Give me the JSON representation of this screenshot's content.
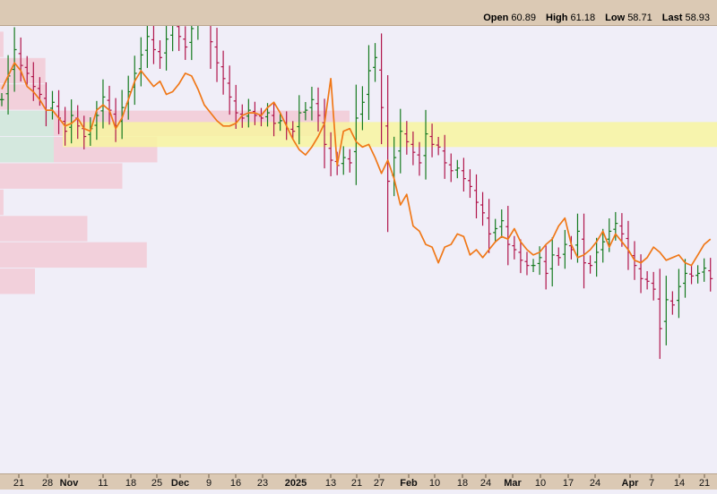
{
  "header": {
    "open_label": "Open",
    "open_value": "60.89",
    "high_label": "High",
    "high_value": "61.18",
    "low_label": "Low",
    "low_value": "58.71",
    "last_label": "Last",
    "last_value": "58.93"
  },
  "chart_data": {
    "type": "ohlc",
    "ylim": [
      51,
      68
    ],
    "grid": false,
    "legend": "none",
    "colors": {
      "up": "#157a1f",
      "down": "#b0154b",
      "sma": "#f07818",
      "highlight_band": "#f8f4a0",
      "profile": "#f2d0db",
      "profile_value_area": "#d4e8de",
      "frame": "#dbc9b4"
    },
    "date_ticks": [
      {
        "label": "21",
        "bold": false
      },
      {
        "label": "28",
        "bold": false
      },
      {
        "label": "Nov",
        "bold": true
      },
      {
        "label": "11",
        "bold": false
      },
      {
        "label": "18",
        "bold": false
      },
      {
        "label": "25",
        "bold": false
      },
      {
        "label": "Dec",
        "bold": true
      },
      {
        "label": "9",
        "bold": false
      },
      {
        "label": "16",
        "bold": false
      },
      {
        "label": "23",
        "bold": false
      },
      {
        "label": "2025",
        "bold": true
      },
      {
        "label": "13",
        "bold": false
      },
      {
        "label": "21",
        "bold": false
      },
      {
        "label": "27",
        "bold": false
      },
      {
        "label": "Feb",
        "bold": true
      },
      {
        "label": "10",
        "bold": false
      },
      {
        "label": "18",
        "bold": false
      },
      {
        "label": "24",
        "bold": false
      },
      {
        "label": "Mar",
        "bold": true
      },
      {
        "label": "10",
        "bold": false
      },
      {
        "label": "17",
        "bold": false
      },
      {
        "label": "24",
        "bold": false
      },
      {
        "label": "Apr",
        "bold": true
      },
      {
        "label": "7",
        "bold": false
      },
      {
        "label": "14",
        "bold": false
      },
      {
        "label": "21",
        "bold": false
      }
    ],
    "highlight_band_range": [
      63.4,
      64.35
    ],
    "volume_profile": [
      {
        "low": 66.8,
        "high": 67.8,
        "volume": 1
      },
      {
        "low": 65.8,
        "high": 66.8,
        "volume": 13
      },
      {
        "low": 64.8,
        "high": 65.8,
        "volume": 13
      },
      {
        "low": 63.8,
        "high": 64.8,
        "volume": 100,
        "value_area": true
      },
      {
        "low": 62.8,
        "high": 63.8,
        "volume": 45,
        "value_area": true
      },
      {
        "low": 61.8,
        "high": 62.8,
        "volume": 35
      },
      {
        "low": 60.8,
        "high": 61.8,
        "volume": 1
      },
      {
        "low": 59.8,
        "high": 60.8,
        "volume": 25
      },
      {
        "low": 58.8,
        "high": 59.8,
        "volume": 42
      },
      {
        "low": 57.8,
        "high": 58.8,
        "volume": 10
      }
    ],
    "close_prices": [
      65.2,
      66.1,
      67.1,
      66.5,
      66.2,
      65.7,
      65.4,
      64.8,
      65.1,
      64.5,
      64.0,
      64.6,
      64.2,
      63.8,
      64.1,
      64.6,
      65.3,
      64.8,
      64.2,
      64.9,
      65.5,
      66.2,
      66.9,
      67.6,
      67.1,
      66.8,
      67.5,
      68.1,
      67.6,
      67.2,
      67.9,
      68.4,
      68.7,
      67.4,
      66.6,
      66.0,
      65.3,
      64.7,
      64.5,
      64.8,
      64.6,
      64.5,
      64.7,
      64.3,
      64.4,
      64.1,
      64.0,
      64.7,
      64.8,
      65.2,
      64.6,
      63.5,
      62.9,
      62.7,
      63.0,
      62.8,
      64.5,
      65.1,
      66.3,
      66.8,
      64.9,
      62.1,
      63.0,
      64.0,
      63.6,
      63.2,
      62.8,
      63.9,
      63.5,
      63.4,
      62.8,
      62.5,
      62.6,
      62.2,
      61.9,
      61.3,
      60.9,
      60.1,
      60.3,
      60.6,
      59.7,
      59.5,
      59.1,
      58.9,
      58.9,
      59.2,
      58.6,
      59.3,
      59.2,
      59.7,
      59.5,
      60.2,
      59.0,
      58.9,
      59.4,
      59.8,
      60.2,
      60.5,
      60.1,
      59.4,
      58.9,
      58.4,
      58.3,
      58.0,
      56.5,
      57.6,
      57.4,
      58.1,
      58.6,
      58.5,
      58.6,
      58.8,
      58.4
    ],
    "sma_line": [
      65.6,
      66.1,
      66.6,
      66.3,
      65.7,
      65.5,
      65.2,
      64.8,
      64.8,
      64.5,
      64.2,
      64.3,
      64.5,
      64.1,
      64.0,
      64.8,
      65.0,
      64.8,
      64.1,
      64.5,
      65.2,
      65.9,
      66.3,
      66.0,
      65.7,
      65.9,
      65.4,
      65.5,
      65.8,
      66.2,
      66.1,
      65.6,
      65.0,
      64.7,
      64.4,
      64.2,
      64.2,
      64.3,
      64.6,
      64.7,
      64.7,
      64.6,
      64.9,
      65.1,
      64.7,
      64.2,
      63.7,
      63.3,
      63.1,
      63.4,
      63.8,
      64.3,
      66.0,
      62.7,
      64.0,
      64.1,
      63.6,
      63.4,
      63.5,
      63.0,
      62.4,
      62.9,
      62.2,
      61.2,
      61.6,
      60.4,
      60.2,
      59.7,
      59.6,
      59.0,
      59.6,
      59.7,
      60.1,
      60.0,
      59.3,
      59.5,
      59.2,
      59.5,
      59.8,
      60.0,
      59.9,
      60.3,
      59.8,
      59.5,
      59.3,
      59.4,
      59.7,
      59.9,
      60.4,
      60.7,
      59.7,
      59.2,
      59.3,
      59.5,
      59.8,
      60.2,
      59.6,
      60.1,
      59.8,
      59.5,
      59.1,
      59.0,
      59.2,
      59.6,
      59.4,
      59.1,
      59.2,
      59.3,
      59.0,
      58.9,
      59.3,
      59.7,
      59.9
    ]
  }
}
